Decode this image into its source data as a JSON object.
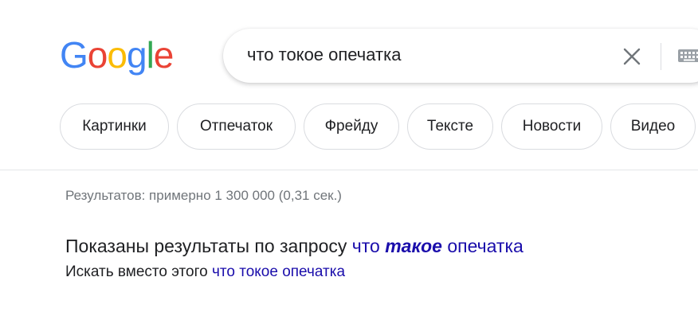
{
  "logo": {
    "letters": [
      "G",
      "o",
      "o",
      "g",
      "l",
      "e"
    ],
    "colors": [
      "#4285F4",
      "#EA4335",
      "#FBBC05",
      "#4285F4",
      "#34A853",
      "#EA4335"
    ]
  },
  "search": {
    "value": "что токое опечатка",
    "clear_icon": "close-icon",
    "keyboard_icon": "keyboard-icon"
  },
  "chips": [
    "Картинки",
    "Отпечаток",
    "Фрейду",
    "Тексте",
    "Новости",
    "Видео"
  ],
  "results": {
    "stats": "Результатов: примерно 1 300 000 (0,31 сек.)"
  },
  "correction": {
    "showing_prefix": "Показаны результаты по запросу",
    "corrected_word1": "что",
    "corrected_bold": "такое",
    "corrected_word3": "опечатка",
    "instead_prefix": "Искать вместо этого",
    "original_query": "что токое опечатка"
  },
  "colors": {
    "link": "#1a0dab",
    "muted": "#70757a",
    "border": "#dadce0"
  }
}
